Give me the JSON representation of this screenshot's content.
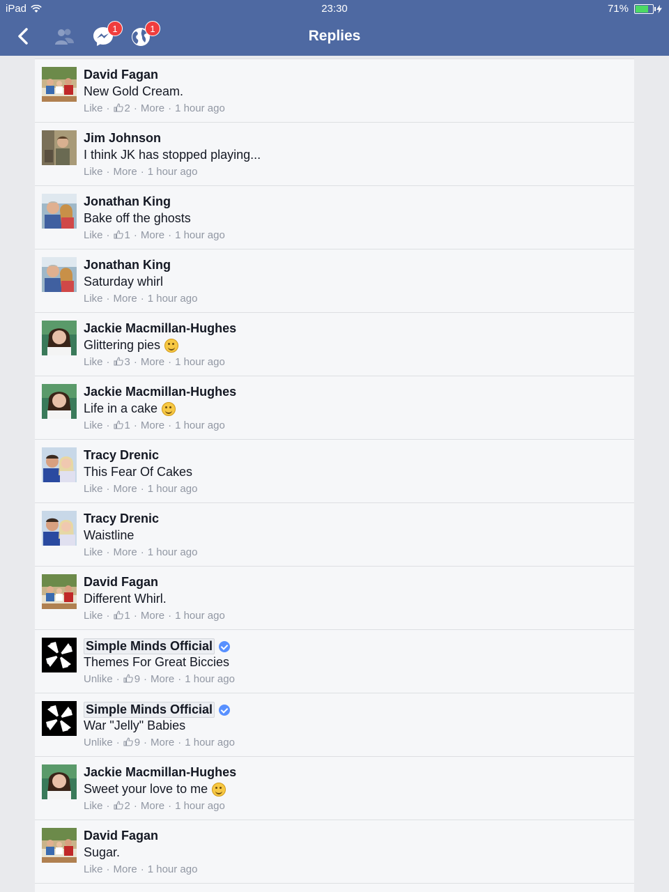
{
  "status_bar": {
    "device": "iPad",
    "time": "23:30",
    "battery": "71%",
    "battery_fraction": 0.71
  },
  "nav": {
    "title": "Replies",
    "messages_badge": "1",
    "notifications_badge": "1",
    "icons": [
      "back-icon",
      "friend-requests-icon",
      "messenger-icon",
      "globe-icon"
    ]
  },
  "labels": {
    "like": "Like",
    "unlike": "Unlike",
    "more": "More",
    "sep": "·"
  },
  "replies": [
    {
      "name": "David Fagan",
      "avatar": "family-photo",
      "text": "New Gold Cream.",
      "action": "Like",
      "likes": "2",
      "time": "1 hour ago",
      "page": false,
      "emoji": ""
    },
    {
      "name": "Jim Johnson",
      "avatar": "man-photo",
      "text": "I think JK has stopped playing...",
      "action": "Like",
      "likes": "",
      "time": "1 hour ago",
      "page": false,
      "emoji": ""
    },
    {
      "name": "Jonathan King",
      "avatar": "couple-photo",
      "text": "Bake off the ghosts",
      "action": "Like",
      "likes": "1",
      "time": "1 hour ago",
      "page": false,
      "emoji": ""
    },
    {
      "name": "Jonathan King",
      "avatar": "couple-photo",
      "text": "Saturday whirl",
      "action": "Like",
      "likes": "",
      "time": "1 hour ago",
      "page": false,
      "emoji": ""
    },
    {
      "name": "Jackie Macmillan-Hughes",
      "avatar": "woman-photo",
      "text": "Glittering pies",
      "action": "Like",
      "likes": "3",
      "time": "1 hour ago",
      "page": false,
      "emoji": "grin"
    },
    {
      "name": "Jackie Macmillan-Hughes",
      "avatar": "woman-photo",
      "text": "Life in a cake",
      "action": "Like",
      "likes": "1",
      "time": "1 hour ago",
      "page": false,
      "emoji": "smile"
    },
    {
      "name": "Tracy Drenic",
      "avatar": "couple2-photo",
      "text": "This Fear Of Cakes",
      "action": "Like",
      "likes": "",
      "time": "1 hour ago",
      "page": false,
      "emoji": ""
    },
    {
      "name": "Tracy Drenic",
      "avatar": "couple2-photo",
      "text": "Waistline",
      "action": "Like",
      "likes": "",
      "time": "1 hour ago",
      "page": false,
      "emoji": ""
    },
    {
      "name": "David Fagan",
      "avatar": "family-photo",
      "text": "Different Whirl.",
      "action": "Like",
      "likes": "1",
      "time": "1 hour ago",
      "page": false,
      "emoji": ""
    },
    {
      "name": "Simple Minds Official",
      "avatar": "simple-minds-logo",
      "text": "Themes For Great Biccies",
      "action": "Unlike",
      "likes": "9",
      "time": "1 hour ago",
      "page": true,
      "emoji": ""
    },
    {
      "name": "Simple Minds Official",
      "avatar": "simple-minds-logo",
      "text": "War \"Jelly\" Babies",
      "action": "Unlike",
      "likes": "9",
      "time": "1 hour ago",
      "page": true,
      "emoji": ""
    },
    {
      "name": "Jackie Macmillan-Hughes",
      "avatar": "woman-photo",
      "text": "Sweet your love to me",
      "action": "Like",
      "likes": "2",
      "time": "1 hour ago",
      "page": false,
      "emoji": "squint"
    },
    {
      "name": "David Fagan",
      "avatar": "family-photo",
      "text": "Sugar.",
      "action": "Like",
      "likes": "",
      "time": "1 hour ago",
      "page": false,
      "emoji": ""
    }
  ],
  "colors": {
    "nav_bar": "#4e69a2",
    "list_bg": "#f6f7f9",
    "meta_text": "#9197a3",
    "badge": "#f03d3d",
    "verified": "#5890ff"
  }
}
